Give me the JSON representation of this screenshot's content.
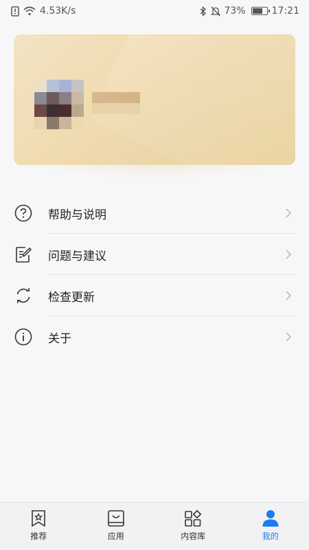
{
  "status_bar": {
    "network_speed": "4.53K/s",
    "battery_percent": "73%",
    "battery_level": 0.73,
    "time": "17:21"
  },
  "profile": {
    "card_colors": [
      "#f3e3c4",
      "#e9d39f"
    ]
  },
  "menu": {
    "items": [
      {
        "label": "帮助与说明",
        "icon": "help-circle-icon"
      },
      {
        "label": "问题与建议",
        "icon": "feedback-edit-icon"
      },
      {
        "label": "检查更新",
        "icon": "refresh-icon"
      },
      {
        "label": "关于",
        "icon": "info-circle-icon"
      }
    ]
  },
  "bottom_nav": {
    "items": [
      {
        "label": "推荐",
        "icon": "bookmark-star-icon",
        "active": false
      },
      {
        "label": "应用",
        "icon": "shopping-bag-icon",
        "active": false
      },
      {
        "label": "内容库",
        "icon": "grid-shapes-icon",
        "active": false
      },
      {
        "label": "我的",
        "icon": "person-icon",
        "active": true
      }
    ],
    "active_color": "#1a7cf2"
  }
}
